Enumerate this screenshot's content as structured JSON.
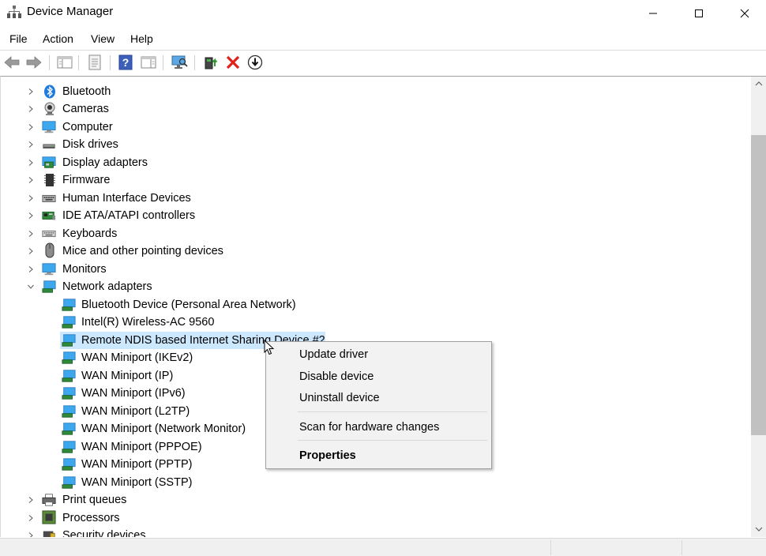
{
  "window": {
    "title": "Device Manager",
    "icons": {
      "app": "device-manager-icon",
      "minimize": "minimize-icon",
      "maximize": "maximize-icon",
      "close": "close-icon"
    }
  },
  "menu": {
    "file": "File",
    "action": "Action",
    "view": "View",
    "help": "Help"
  },
  "toolbar": {
    "buttons": [
      "back-icon",
      "forward-icon",
      "show-hide-console-tree-icon",
      "properties-icon",
      "help-icon",
      "show-hide-action-pane-icon",
      "scan-hardware-icon",
      "update-driver-icon",
      "uninstall-icon",
      "disable-icon"
    ]
  },
  "tree": {
    "categories": [
      {
        "label": "Bluetooth",
        "icon": "bluetooth-icon",
        "expanded": false
      },
      {
        "label": "Cameras",
        "icon": "camera-icon",
        "expanded": false
      },
      {
        "label": "Computer",
        "icon": "computer-icon",
        "expanded": false
      },
      {
        "label": "Disk drives",
        "icon": "disk-drive-icon",
        "expanded": false
      },
      {
        "label": "Display adapters",
        "icon": "display-adapter-icon",
        "expanded": false
      },
      {
        "label": "Firmware",
        "icon": "firmware-icon",
        "expanded": false
      },
      {
        "label": "Human Interface Devices",
        "icon": "hid-icon",
        "expanded": false
      },
      {
        "label": "IDE ATA/ATAPI controllers",
        "icon": "ide-controller-icon",
        "expanded": false
      },
      {
        "label": "Keyboards",
        "icon": "keyboard-icon",
        "expanded": false
      },
      {
        "label": "Mice and other pointing devices",
        "icon": "mouse-icon",
        "expanded": false
      },
      {
        "label": "Monitors",
        "icon": "monitor-icon",
        "expanded": false
      },
      {
        "label": "Network adapters",
        "icon": "network-adapter-icon",
        "expanded": true
      }
    ],
    "network_devices": [
      "Bluetooth Device (Personal Area Network)",
      "Intel(R) Wireless-AC 9560",
      "Remote NDIS based Internet Sharing Device #2",
      "WAN Miniport (IKEv2)",
      "WAN Miniport (IP)",
      "WAN Miniport (IPv6)",
      "WAN Miniport (L2TP)",
      "WAN Miniport (Network Monitor)",
      "WAN Miniport (PPPOE)",
      "WAN Miniport (PPTP)",
      "WAN Miniport (SSTP)"
    ],
    "selected_device": "Remote NDIS based Internet Sharing Device #2",
    "after_categories": [
      {
        "label": "Print queues",
        "icon": "printer-icon"
      },
      {
        "label": "Processors",
        "icon": "processor-icon"
      },
      {
        "label": "Security devices",
        "icon": "security-device-icon"
      }
    ]
  },
  "context_menu": {
    "update_driver": "Update driver",
    "disable_device": "Disable device",
    "uninstall_device": "Uninstall device",
    "scan": "Scan for hardware changes",
    "properties": "Properties"
  },
  "colors": {
    "selection": "#cce8ff",
    "menu_bg": "#f2f2f2",
    "scrollbar": "#f0f0f0",
    "thumb": "#c1c1c1"
  }
}
